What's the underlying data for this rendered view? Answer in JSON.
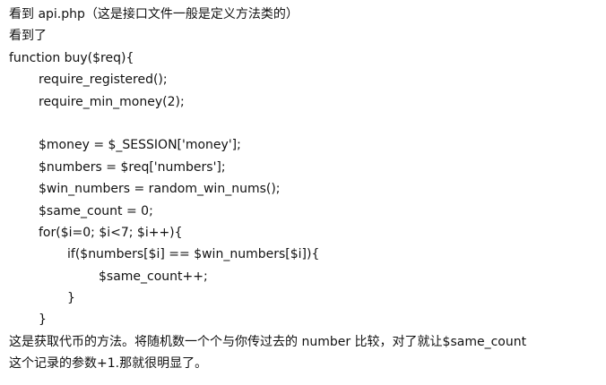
{
  "intro": "看到 api.php（这是接口文件一般是定义方法类的）",
  "seen": "看到了",
  "code": {
    "l1": "function buy($req){",
    "l2": "require_registered();",
    "l3": "require_min_money(2);",
    "l4": "$money = $_SESSION['money'];",
    "l5": "$numbers = $req['numbers'];",
    "l6": "$win_numbers = random_win_nums();",
    "l7": "$same_count = 0;",
    "l8": "for($i=0; $i<7; $i++){",
    "l9": "if($numbers[$i] == $win_numbers[$i]){",
    "l10": "$same_count++;",
    "l11": "}",
    "l12": "}"
  },
  "explanation": {
    "line1": "这是获取代币的方法。将随机数一个个与你传过去的 number 比较，对了就让$same_count",
    "line2": "这个记录的参数+1.那就很明显了。"
  }
}
